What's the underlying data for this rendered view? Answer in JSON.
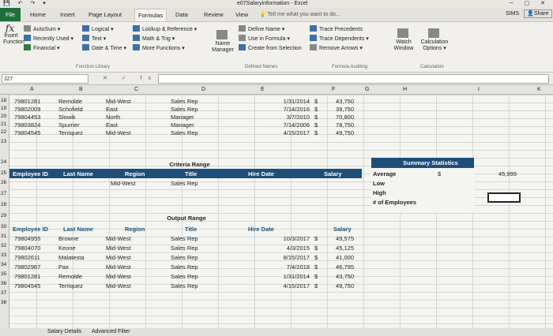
{
  "titlebar": {
    "qat": "💾 ↶ ↷ ▾",
    "title": "e07Salaryinformation - Excel",
    "win_controls": "─ ▢ ✕"
  },
  "tabs": [
    "File",
    "Home",
    "Insert",
    "Page Layout",
    "Formulas",
    "Data",
    "Review",
    "View"
  ],
  "tell_me": "Tell me what you want to do...",
  "user": "SIMS",
  "share": "Share",
  "ribbon": {
    "insert_function": "Insert Function",
    "autosum": "AutoSum",
    "recently_used": "Recently Used",
    "financial": "Financial",
    "logical": "Logical",
    "text": "Text",
    "date_time": "Date & Time",
    "lookup_ref": "Lookup & Reference",
    "math_trig": "Math & Trig",
    "more_functions": "More Functions",
    "group_function_library": "Function Library",
    "name_manager": "Name Manager",
    "define_name": "Define Name",
    "use_in_formula": "Use in Formula",
    "create_from_selection": "Create from Selection",
    "group_defined_names": "Defined Names",
    "trace_precedents": "Trace Precedents",
    "trace_dependents": "Trace Dependents",
    "remove_arrows": "Remove Arrows",
    "group_formula_auditing": "Formula Auditing",
    "watch_window": "Watch Window",
    "calc_options": "Calculation Options",
    "group_calculation": "Calculation"
  },
  "formula_bar": {
    "name_box": "J27",
    "buttons": "✕ ✓ fx",
    "formula": ""
  },
  "columns": [
    "A",
    "B",
    "C",
    "D",
    "E",
    "F",
    "G",
    "H",
    "I",
    "K"
  ],
  "rows": [
    "18",
    "19",
    "20",
    "21",
    "22",
    "23",
    "24",
    "25",
    "26",
    "27",
    "28",
    "29",
    "30",
    "31",
    "32",
    "33",
    "34",
    "35",
    "36",
    "37",
    "38"
  ],
  "data_rows": [
    [
      "79801281",
      "Remolde",
      "Mid-West",
      "Sales Rep",
      "1/31/2014",
      "$",
      "43,750"
    ],
    [
      "79802009",
      "Schofield",
      "East",
      "Sales Rep",
      "7/14/2016",
      "$",
      "39,750"
    ],
    [
      "79804453",
      "Slowik",
      "North",
      "Manager",
      "3/7/2010",
      "$",
      "70,800"
    ],
    [
      "79803824",
      "Spurrier",
      "East",
      "Manager",
      "7/14/2006",
      "$",
      "78,750"
    ],
    [
      "79804545",
      "Terriquez",
      "Mid-West",
      "Sales Rep",
      "4/15/2017",
      "$",
      "49,750"
    ]
  ],
  "criteria": {
    "title": "Criteria Range",
    "headers": [
      "Employee ID",
      "Last Name",
      "Region",
      "Title",
      "Hire Date",
      "Salary"
    ],
    "values": [
      "",
      "",
      "Mid-West",
      "Sales Rep",
      "",
      ""
    ]
  },
  "stats": {
    "title": "Summary Statistics",
    "average_label": "Average",
    "average_currency": "$",
    "average_value": "45,999",
    "low_label": "Low",
    "high_label": "High",
    "count_label": "# of Employees"
  },
  "output": {
    "title": "Output Range",
    "headers": [
      "Employee ID",
      "Last Name",
      "Region",
      "Title",
      "Hire Date",
      "Salary"
    ],
    "rows": [
      [
        "79804955",
        "Browne",
        "Mid-West",
        "Sales Rep",
        "10/3/2017",
        "$",
        "49,575"
      ],
      [
        "79804070",
        "Keone",
        "Mid-West",
        "Sales Rep",
        "4/3/2015",
        "$",
        "45,125"
      ],
      [
        "79802611",
        "Malatesta",
        "Mid-West",
        "Sales Rep",
        "8/15/2017",
        "$",
        "41,000"
      ],
      [
        "79802967",
        "Pax",
        "Mid-West",
        "Sales Rep",
        "7/4/2018",
        "$",
        "46,795"
      ],
      [
        "79801281",
        "Remolde",
        "Mid-West",
        "Sales Rep",
        "1/31/2014",
        "$",
        "43,750"
      ],
      [
        "79804545",
        "Terriquez",
        "Mid-West",
        "Sales Rep",
        "4/15/2017",
        "$",
        "49,750"
      ]
    ]
  },
  "sheet_tabs": [
    "Salary Details",
    "Advanced Filter"
  ],
  "colors": {
    "file_tab": "#1e6f3a",
    "header_band": "#1f4e79"
  }
}
